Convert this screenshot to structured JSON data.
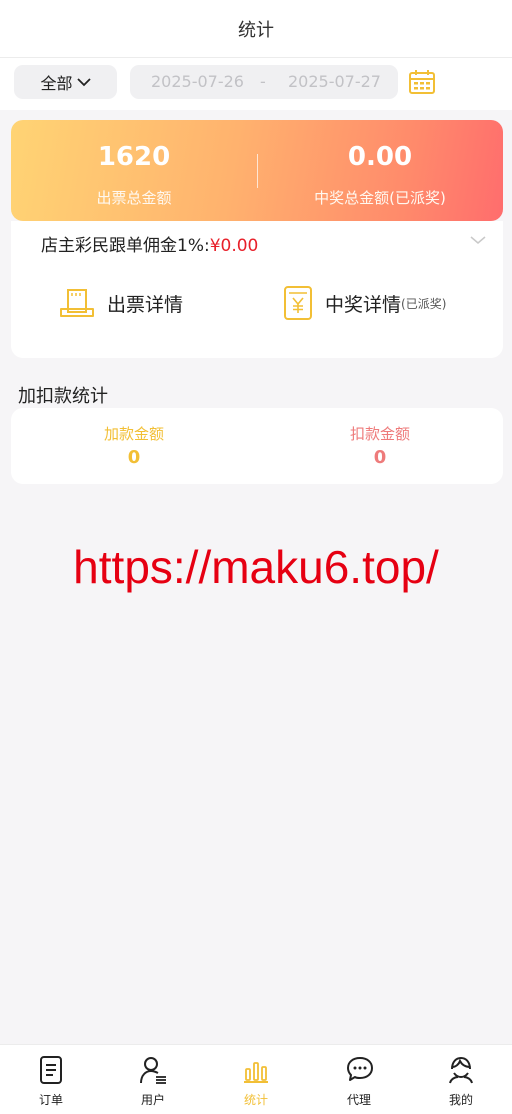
{
  "header": {
    "title": "统计"
  },
  "filter": {
    "scope_label": "全部",
    "date_start": "2025-07-26",
    "date_separator": "-",
    "date_end": "2025-07-27"
  },
  "summary": {
    "ticket_total": "1620",
    "ticket_total_label": "出票总金额",
    "prize_total": "0.00",
    "prize_total_label": "中奖总金额(已派奖)"
  },
  "details": {
    "commission_label": "店主彩民跟单佣金1%:",
    "commission_amount": "¥0.00",
    "ticket_detail_label": "出票详情",
    "prize_detail_label": "中奖详情",
    "prize_detail_note": "(已派奖)"
  },
  "adjustments": {
    "section_title": "加扣款统计",
    "add_label": "加款金额",
    "add_value": "0",
    "deduct_label": "扣款金额",
    "deduct_value": "0"
  },
  "watermark": "https://maku6.top/",
  "tabs": [
    {
      "label": "订单",
      "icon": "document-icon",
      "active": false
    },
    {
      "label": "用户",
      "icon": "user-icon",
      "active": false
    },
    {
      "label": "统计",
      "icon": "bar-chart-icon",
      "active": true
    },
    {
      "label": "代理",
      "icon": "chat-bubbles-icon",
      "active": false
    },
    {
      "label": "我的",
      "icon": "profile-icon",
      "active": false
    }
  ],
  "colors": {
    "accent": "#f2bf35",
    "prize_red": "#e8202a",
    "deduct": "#ee7b7b",
    "watermark": "#e60012"
  }
}
